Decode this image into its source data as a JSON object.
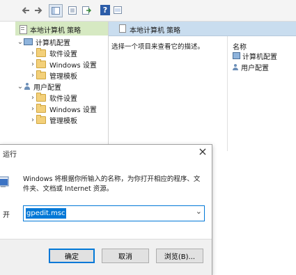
{
  "gpedit": {
    "tree": {
      "root_label": "本地计算机 策略",
      "computer_config": "计算机配置",
      "user_config": "用户配置",
      "computer_children": [
        "软件设置",
        "Windows 设置",
        "管理模板"
      ],
      "user_children": [
        "软件设置",
        "Windows 设置",
        "管理模板"
      ]
    },
    "right": {
      "header_title": "本地计算机 策略",
      "description_prompt": "选择一个项目来查看它的描述。",
      "name_column": "名称",
      "items": [
        "计算机配置",
        "用户配置"
      ]
    }
  },
  "run_dialog": {
    "title": "运行",
    "close_symbol": "×",
    "description": "Windows 将根据你所输入的名称，为你打开相应的程序、文件夹、文档或 Internet 资源。",
    "open_label": "开",
    "command_value": "gpedit.msc",
    "dropdown_symbol": "⌄",
    "ok_label": "确定",
    "cancel_label": "取消",
    "browse_label": "浏览(B)..."
  },
  "colors": {
    "tree_header": "#d6e9c2",
    "right_header": "#c9ddef",
    "selection": "#0078d7"
  },
  "icons": [
    "back-arrow-icon",
    "forward-arrow-icon",
    "show-tree-icon",
    "properties-icon",
    "export-icon",
    "help-icon",
    "view-icon",
    "folder-icon",
    "computer-icon",
    "user-icon",
    "policy-icon",
    "run-app-icon",
    "close-icon",
    "dropdown-icon"
  ]
}
